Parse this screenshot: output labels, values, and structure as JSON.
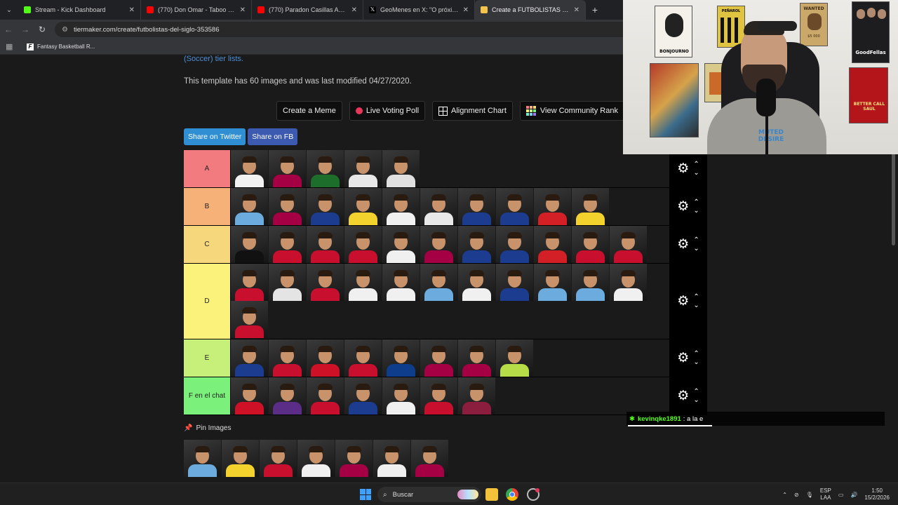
{
  "tabs": [
    {
      "title": "Stream - Kick Dashboard",
      "color": "#53fc18",
      "active": false
    },
    {
      "title": "(770) Don Omar - Taboo - YouT",
      "color": "#ff0000",
      "active": false
    },
    {
      "title": "(770) Paradon Casillas Audio Ca",
      "color": "#ff0000",
      "active": false
    },
    {
      "title": "GeoMenes en X: \"O próximo so",
      "color": "#000000",
      "active": false
    },
    {
      "title": "Create a FUTBOLISTAS DEL SIGL",
      "color": "#f6c44a",
      "active": true
    }
  ],
  "address": {
    "url": "tiermaker.com/create/futbolistas-del-siglo-353586"
  },
  "bookmarks": [
    {
      "label": "Fantasy Basketball R...",
      "icon": "F"
    }
  ],
  "page": {
    "link_cont": "(Soccer) tier lists.",
    "template_info": "This template has 60 images and was last modified 04/27/2020.",
    "actions": {
      "create_meme": "Create a Meme",
      "live_voting": "Live Voting Poll",
      "alignment": "Alignment Chart",
      "community_rank": "View Community Rank"
    },
    "share": {
      "twitter": "Share on Twitter",
      "facebook": "Share on FB"
    },
    "tiers": [
      {
        "label": "A",
        "color": "#f27b80",
        "count": 5,
        "kits": [
          "#f2f2f2",
          "#a50044",
          "#1d6e2a",
          "#e8e8e8",
          "#e0e0e0"
        ]
      },
      {
        "label": "B",
        "color": "#f6b179",
        "count": 10,
        "kits": [
          "#6cabdd",
          "#a50044",
          "#1b3c8f",
          "#f4d22e",
          "#f0f0f0",
          "#e8e8e8",
          "#1b3c8f",
          "#1b3c8f",
          "#d32027",
          "#f4d22e"
        ]
      },
      {
        "label": "C",
        "color": "#f6d77b",
        "count": 11,
        "kits": [
          "#111111",
          "#c8102e",
          "#c8102e",
          "#c8102e",
          "#f0f0f0",
          "#a50044",
          "#1b3c8f",
          "#1b3c8f",
          "#d32027",
          "#c8102e",
          "#c8102e"
        ]
      },
      {
        "label": "D",
        "color": "#fbf27b",
        "count": 12,
        "kits": [
          "#c8102e",
          "#e4e4e4",
          "#c8102e",
          "#f0f0f0",
          "#f0f0f0",
          "#6cabdd",
          "#f0f0f0",
          "#1b3c8f",
          "#6cabdd",
          "#6cabdd",
          "#f0f0f0",
          "#c8102e"
        ]
      },
      {
        "label": "E",
        "color": "#c6f07a",
        "count": 8,
        "kits": [
          "#1b3c8f",
          "#c8102e",
          "#ce1126",
          "#c8102e",
          "#0e3d8c",
          "#a50044",
          "#a50044",
          "#b6dd47"
        ]
      },
      {
        "label": "F en el chat",
        "color": "#7bf07b",
        "count": 7,
        "kits": [
          "#ce1126",
          "#5b2d86",
          "#c8102e",
          "#1b3c8f",
          "#f0f0f0",
          "#c8102e",
          "#8b1e3f"
        ]
      }
    ],
    "pin_label": "Pin Images",
    "pin_images": {
      "count": 7,
      "kits": [
        "#6cabdd",
        "#f4d22e",
        "#c8102e",
        "#f0f0f0",
        "#a50044",
        "#f0f0f0",
        "#a50044"
      ]
    }
  },
  "chat": {
    "user": "kevinqke1891",
    "message": ": a la e"
  },
  "webcam": {
    "poster_bonjourno": "BONJOURNO",
    "poster_wanted": "WANTED",
    "poster_wanted_amount": "$5 000",
    "poster_goodfellas": "GoodFellas",
    "poster_penarol": "PEÑAROL",
    "poster_betterc": "BETTER CALL SAUL",
    "hoodie_text": "MUTED DESIRE"
  },
  "taskbar": {
    "search": "Buscar",
    "lang_top": "ESP",
    "lang_bottom": "LAA",
    "time": "1:50",
    "date": "15/2/2026"
  }
}
